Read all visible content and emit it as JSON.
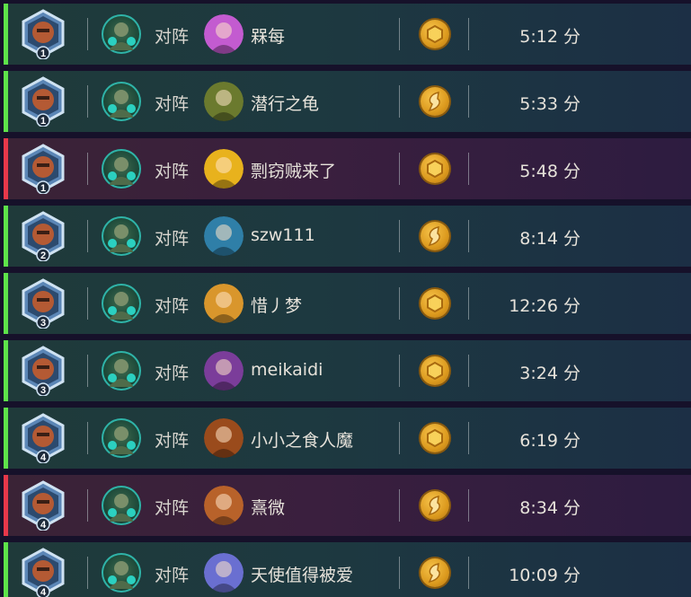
{
  "matches": [
    {
      "result": "win",
      "rank": "1",
      "versus": "对阵",
      "opponent": "槑每",
      "mode": "coin",
      "duration": "5:12 分",
      "opp_color": "#c35bd0"
    },
    {
      "result": "win",
      "rank": "1",
      "versus": "对阵",
      "opponent": "潜行之龟",
      "mode": "swirl",
      "duration": "5:33 分",
      "opp_color": "#6b7a2e"
    },
    {
      "result": "loss",
      "rank": "1",
      "versus": "对阵",
      "opponent": "剽窃贼来了",
      "mode": "coin",
      "duration": "5:48 分",
      "opp_color": "#e8b21d"
    },
    {
      "result": "win",
      "rank": "2",
      "versus": "对阵",
      "opponent": "szw111",
      "mode": "swirl",
      "duration": "8:14 分",
      "opp_color": "#2f7fa8"
    },
    {
      "result": "win",
      "rank": "3",
      "versus": "对阵",
      "opponent": "惜丿梦",
      "mode": "coin",
      "duration": "12:26 分",
      "opp_color": "#d9962c"
    },
    {
      "result": "win",
      "rank": "3",
      "versus": "对阵",
      "opponent": "meikaidi",
      "mode": "coin",
      "duration": "3:24 分",
      "opp_color": "#7b3d9a"
    },
    {
      "result": "win",
      "rank": "4",
      "versus": "对阵",
      "opponent": "小小之食人魔",
      "mode": "coin",
      "duration": "6:19 分",
      "opp_color": "#9a4b1c"
    },
    {
      "result": "loss",
      "rank": "4",
      "versus": "对阵",
      "opponent": "熹微",
      "mode": "swirl",
      "duration": "8:34 分",
      "opp_color": "#b8622a"
    },
    {
      "result": "win",
      "rank": "4",
      "versus": "对阵",
      "opponent": "天使值得被爱",
      "mode": "swirl",
      "duration": "10:09 分",
      "opp_color": "#6a6fd1"
    }
  ]
}
